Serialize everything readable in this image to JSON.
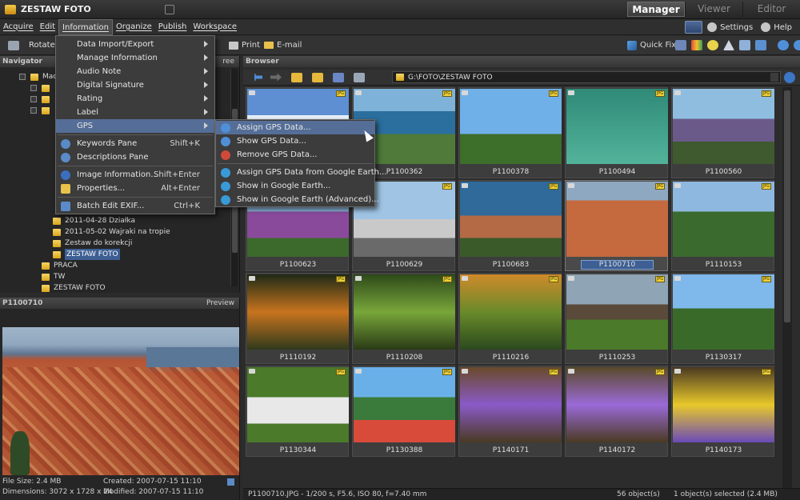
{
  "app": {
    "title": "ZESTAW FOTO",
    "modes": [
      "Manager",
      "Viewer",
      "Editor"
    ]
  },
  "menubar": {
    "menus": [
      "Acquire",
      "Edit",
      "Information",
      "Organize",
      "Publish",
      "Workspace"
    ],
    "settings_label": "Settings",
    "help_label": "Help"
  },
  "toolbar": {
    "rotate_label": "Rotate:",
    "print_label": "Print",
    "email_label": "E-mail",
    "quickfix_label": "Quick Fix"
  },
  "navigator": {
    "header": "Navigator",
    "header_right": "ree",
    "root_label": "Mac",
    "folders": [
      "2011-04-28 Działka",
      "2011-05-02 Wajraki na tropie",
      "Zestaw do korekcji",
      "ZESTAW FOTO",
      "PRACA",
      "TW",
      "ZESTAW FOTO"
    ]
  },
  "preview": {
    "header": "P1100710",
    "header_right": "Preview",
    "file_size": "File Size: 2.4 MB",
    "dimensions": "Dimensions: 3072 x 1728 x 24",
    "created": "Created: 2007-07-15 11:10",
    "modified": "Modified: 2007-07-15 11:10"
  },
  "browser": {
    "header": "Browser",
    "path": "G:\\FOTO\\ZESTAW FOTO",
    "thumbnails": [
      "",
      "P1100362",
      "P1100378",
      "P1100494",
      "P1100560",
      "P1100623",
      "P1100629",
      "P1100683",
      "P1100710",
      "P1110153",
      "P1110192",
      "P1110208",
      "P1110216",
      "P1110253",
      "P1130317",
      "P1130344",
      "P1130388",
      "P1140171",
      "P1140172",
      "P1140173"
    ],
    "jpg_badge": "JPG",
    "status_info": "P1100710.JPG - 1/200 s, F5.6, ISO 80, f=7.40 mm",
    "status_count": "56 object(s)",
    "status_selected": "1 object(s) selected (2.4 MB)"
  },
  "information_menu": {
    "items": [
      {
        "label": "Data Import/Export",
        "shortcut": "",
        "submenu": true
      },
      {
        "label": "Manage Information",
        "shortcut": "",
        "submenu": true
      },
      {
        "label": "Audio Note",
        "shortcut": "",
        "submenu": true
      },
      {
        "label": "Digital Signature",
        "shortcut": "",
        "submenu": true
      },
      {
        "label": "Rating",
        "shortcut": "",
        "submenu": true
      },
      {
        "label": "Label",
        "shortcut": "",
        "submenu": true
      },
      {
        "label": "GPS",
        "shortcut": "",
        "submenu": true
      },
      {
        "label": "Keywords Pane",
        "shortcut": "Shift+K",
        "submenu": false
      },
      {
        "label": "Descriptions Pane",
        "shortcut": "",
        "submenu": false
      },
      {
        "label": "Image Information...",
        "shortcut": "Shift+Enter",
        "submenu": false
      },
      {
        "label": "Properties...",
        "shortcut": "Alt+Enter",
        "submenu": false
      },
      {
        "label": "Batch Edit EXIF...",
        "shortcut": "Ctrl+K",
        "submenu": false
      }
    ]
  },
  "gps_submenu": {
    "items": [
      "Assign GPS Data...",
      "Show GPS Data...",
      "Remove GPS Data...",
      "Assign GPS Data from Google Earth...",
      "Show in Google Earth...",
      "Show in Google Earth (Advanced)..."
    ]
  },
  "colors": {
    "accent": "#556e98",
    "selection": "#3d5f93",
    "folder": "#e8bb34"
  }
}
